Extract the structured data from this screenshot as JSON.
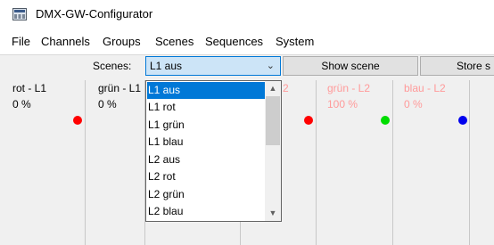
{
  "window": {
    "title": "DMX-GW-Configurator",
    "icon": "app-icon"
  },
  "menu": [
    "File",
    "Channels",
    "Groups",
    "Scenes",
    "Sequences",
    "System"
  ],
  "toolbar": {
    "scenes_label": "Scenes:",
    "selected_scene": "L1 aus",
    "show_scene_label": "Show scene",
    "store_scene_label": "Store s"
  },
  "dropdown": {
    "options": [
      "L1 aus",
      "L1 rot",
      "L1 grün",
      "L1 blau",
      "L2 aus",
      "L2 rot",
      "L2 grün",
      "L2 blau"
    ],
    "selected_index": 0
  },
  "channels": [
    {
      "name": "rot - L1",
      "value": "0 %",
      "color": "#ff0000",
      "enabled": true
    },
    {
      "name": "grün - L1",
      "value": "0 %",
      "color": "#ff0000",
      "enabled": true
    },
    {
      "name": "2",
      "value": "",
      "color": "#ff0000",
      "enabled": false
    },
    {
      "name": "grün - L2",
      "value": "100 %",
      "color": "#00dd00",
      "enabled": false
    },
    {
      "name": "blau - L2",
      "value": "0 %",
      "color": "#0000ee",
      "enabled": false
    }
  ]
}
